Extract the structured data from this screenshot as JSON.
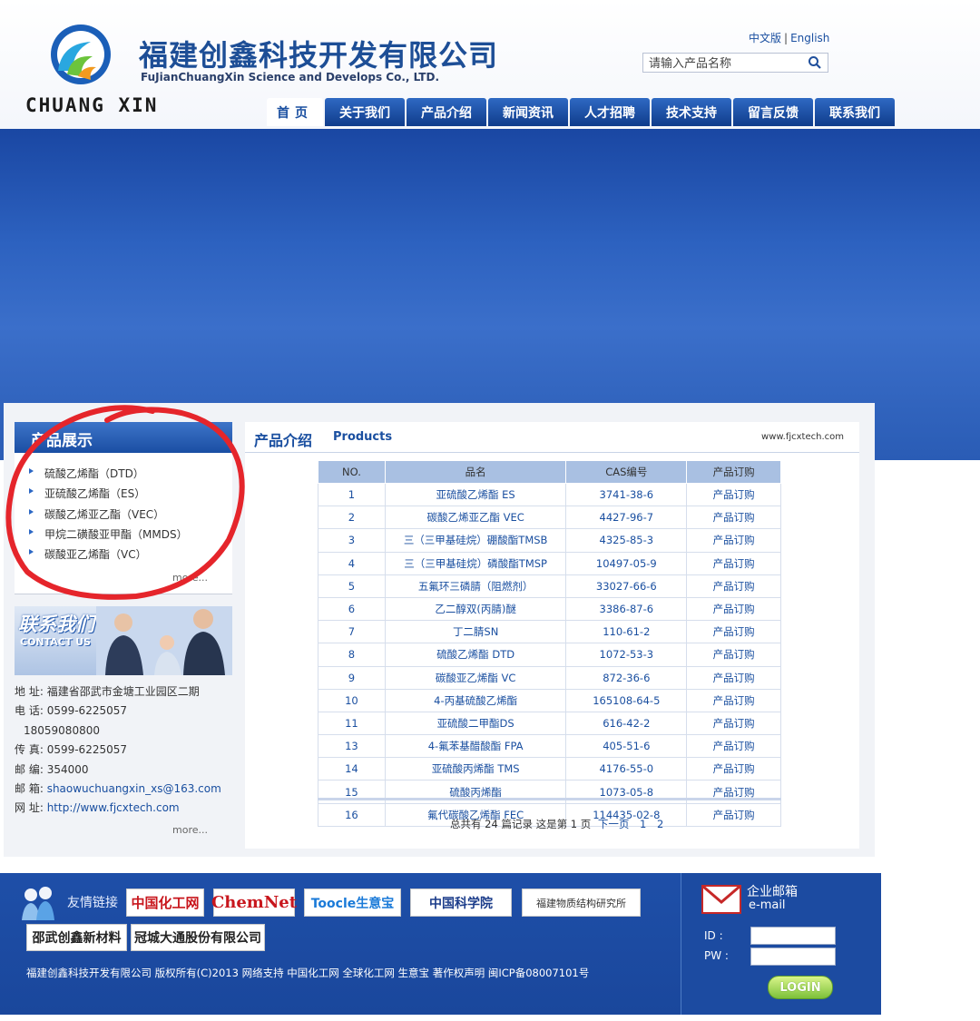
{
  "header": {
    "company_cn": "福建创鑫科技开发有限公司",
    "company_en": "FuJianChuangXin Science and Develops Co., LTD.",
    "logo_text": "CHUANG XIN",
    "lang_cn": "中文版",
    "lang_sep": "|",
    "lang_en": "English",
    "search_placeholder": "请输入产品名称"
  },
  "nav": [
    "首页",
    "关于我们",
    "产品介绍",
    "新闻资讯",
    "人才招聘",
    "技术支持",
    "留言反馈",
    "联系我们"
  ],
  "left": {
    "title": "产品展示",
    "items": [
      "硫酸乙烯酯（DTD）",
      "亚硫酸乙烯酯（ES）",
      "碳酸乙烯亚乙酯（VEC）",
      "甲烷二磺酸亚甲酯（MMDS）",
      "碳酸亚乙烯酯（VC）"
    ],
    "more": "more...",
    "contact_cn": "联系我们",
    "contact_en": "CONTACT US",
    "contact": {
      "address_label": "地 址:",
      "address": "福建省邵武市金塘工业园区二期",
      "phone_label": "电 话:",
      "phone": "0599-6225057",
      "mobile": "18059080800",
      "fax_label": "传 真:",
      "fax": "0599-6225057",
      "zip_label": "邮 编:",
      "zip": "354000",
      "email_label": "邮 箱:",
      "email": "shaowuchuangxin_xs@163.com",
      "web_label": "网 址:",
      "web": "http://www.fjcxtech.com"
    },
    "more2": "more..."
  },
  "products": {
    "title_cn": "产品介绍",
    "title_en": "Products",
    "site": "www.fjcxtech.com",
    "columns": [
      "NO.",
      "品名",
      "CAS编号",
      "产品订购"
    ],
    "rows": [
      [
        "1",
        "亚硫酸乙烯酯 ES",
        "3741-38-6",
        "产品订购"
      ],
      [
        "2",
        "碳酸乙烯亚乙酯 VEC",
        "4427-96-7",
        "产品订购"
      ],
      [
        "3",
        "三（三甲基硅烷）硼酸酯TMSB",
        "4325-85-3",
        "产品订购"
      ],
      [
        "4",
        "三（三甲基硅烷）磷酸酯TMSP",
        "10497-05-9",
        "产品订购"
      ],
      [
        "5",
        "五氟环三磷腈（阻燃剂）",
        "33027-66-6",
        "产品订购"
      ],
      [
        "6",
        "乙二醇双(丙腈)醚",
        "3386-87-6",
        "产品订购"
      ],
      [
        "7",
        "丁二腈SN",
        "110-61-2",
        "产品订购"
      ],
      [
        "8",
        "硫酸乙烯酯 DTD",
        "1072-53-3",
        "产品订购"
      ],
      [
        "9",
        "碳酸亚乙烯酯 VC",
        "872-36-6",
        "产品订购"
      ],
      [
        "10",
        "4-丙基硫酸乙烯酯",
        "165108-64-5",
        "产品订购"
      ],
      [
        "11",
        "亚硫酸二甲酯DS",
        "616-42-2",
        "产品订购"
      ],
      [
        "13",
        "4-氟苯基醋酸酯 FPA",
        "405-51-6",
        "产品订购"
      ],
      [
        "14",
        "亚硫酸丙烯酯 TMS",
        "4176-55-0",
        "产品订购"
      ],
      [
        "15",
        "硫酸丙烯酯",
        "1073-05-8",
        "产品订购"
      ],
      [
        "16",
        "氟代碳酸乙烯酯 FEC",
        "114435-02-8",
        "产品订购"
      ]
    ],
    "pager_text": "总共有 24 篇记录 这是第 1 页",
    "pager_next": "下一页",
    "pager_p1": "1",
    "pager_p2": "2"
  },
  "footer": {
    "friend_label": "友情链接",
    "links": [
      "中国化工网",
      "ChemNet",
      "Toocle生意宝",
      "中国科学院",
      "福建物质结构研究所",
      "邵武创鑫新材料",
      "冠城大通股份有限公司"
    ],
    "copyright": "福建创鑫科技开发有限公司 版权所有(C)2013  网络支持 中国化工网 全球化工网 生意宝 著作权声明 闽ICP备08007101号",
    "email_cn": "企业邮箱",
    "email_en": "e-mail",
    "id_label": "ID  :",
    "pw_label": "PW :",
    "login": "LOGIN"
  }
}
